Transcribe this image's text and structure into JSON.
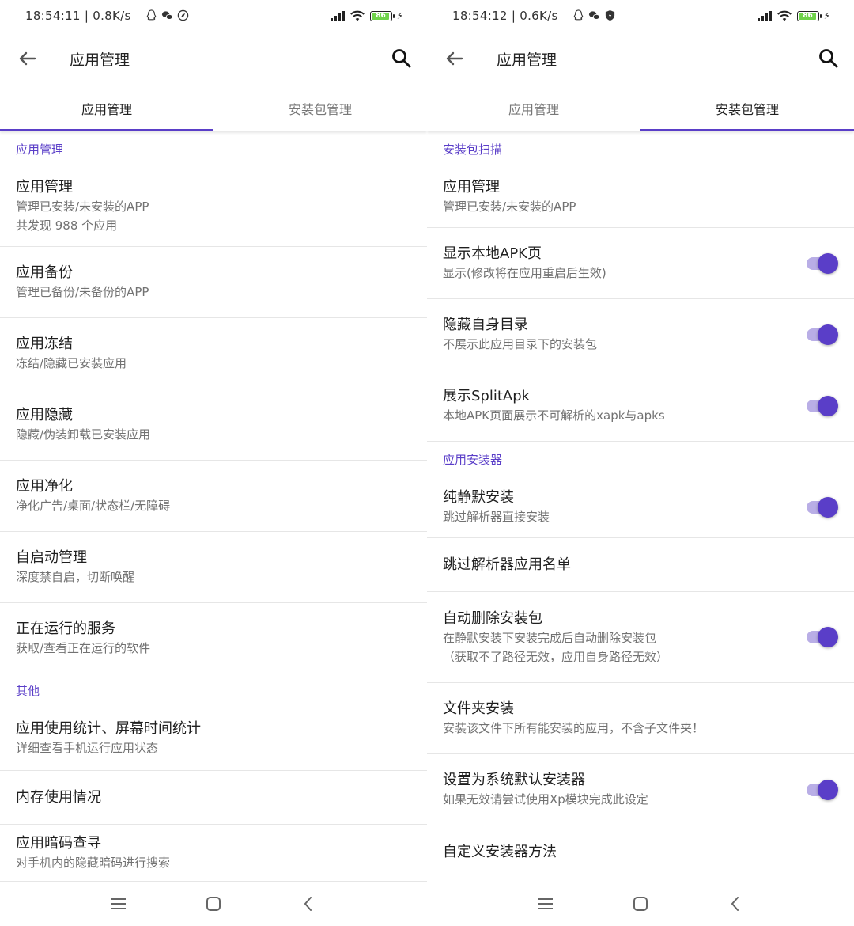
{
  "left": {
    "status": {
      "time_speed": "18:54:11 | 0.8K/s",
      "battery": "86"
    },
    "appbar": {
      "title": "应用管理"
    },
    "tabs": [
      "应用管理",
      "安装包管理"
    ],
    "sections": [
      {
        "header": "应用管理",
        "items": [
          {
            "title": "应用管理",
            "subs": [
              "管理已安装/未安装的APP",
              "共发现 988 个应用"
            ]
          },
          {
            "title": "应用备份",
            "subs": [
              "管理已备份/未备份的APP"
            ]
          },
          {
            "title": "应用冻结",
            "subs": [
              "冻结/隐藏已安装应用"
            ]
          },
          {
            "title": "应用隐藏",
            "subs": [
              "隐藏/伪装卸载已安装应用"
            ]
          },
          {
            "title": "应用净化",
            "subs": [
              "净化广告/桌面/状态栏/无障碍"
            ]
          },
          {
            "title": "自启动管理",
            "subs": [
              "深度禁自启，切断唤醒"
            ]
          },
          {
            "title": "正在运行的服务",
            "subs": [
              "获取/查看正在运行的软件"
            ]
          }
        ]
      },
      {
        "header": "其他",
        "items": [
          {
            "title": "应用使用统计、屏幕时间统计",
            "subs": [
              "详细查看手机运行应用状态"
            ]
          },
          {
            "title": "内存使用情况",
            "subs": []
          },
          {
            "title": "应用暗码查寻",
            "subs": [
              "对手机内的隐藏暗码进行搜索"
            ]
          }
        ]
      }
    ]
  },
  "right": {
    "status": {
      "time_speed": "18:54:12 | 0.6K/s",
      "battery": "86"
    },
    "appbar": {
      "title": "应用管理"
    },
    "tabs": [
      "应用管理",
      "安装包管理"
    ],
    "sections": [
      {
        "header": "安装包扫描",
        "items": [
          {
            "title": "应用管理",
            "subs": [
              "管理已安装/未安装的APP"
            ],
            "toggle": null
          },
          {
            "title": "显示本地APK页",
            "subs": [
              "显示(修改将在应用重启后生效)"
            ],
            "toggle": true
          },
          {
            "title": "隐藏自身目录",
            "subs": [
              "不展示此应用目录下的安装包"
            ],
            "toggle": true
          },
          {
            "title": "展示SplitApk",
            "subs": [
              "本地APK页面展示不可解析的xapk与apks"
            ],
            "toggle": true
          }
        ]
      },
      {
        "header": "应用安装器",
        "items": [
          {
            "title": "纯静默安装",
            "subs": [
              "跳过解析器直接安装"
            ],
            "toggle": true
          },
          {
            "title": "跳过解析器应用名单",
            "subs": [],
            "toggle": null
          },
          {
            "title": "自动删除安装包",
            "subs": [
              "在静默安装下安装完成后自动删除安装包",
              "（获取不了路径无效，应用自身路径无效）"
            ],
            "toggle": true
          },
          {
            "title": "文件夹安装",
            "subs": [
              "安装该文件下所有能安装的应用，不含子文件夹！"
            ],
            "toggle": null
          },
          {
            "title": "设置为系统默认安装器",
            "subs": [
              "如果无效请尝试使用Xp模块完成此设定"
            ],
            "toggle": true
          },
          {
            "title": "自定义安装器方法",
            "subs": [],
            "toggle": null
          }
        ]
      }
    ]
  },
  "colors": {
    "accent": "#5a3ec8",
    "toggle_track": "#b9aee6",
    "divider": "#e6e6e6"
  }
}
